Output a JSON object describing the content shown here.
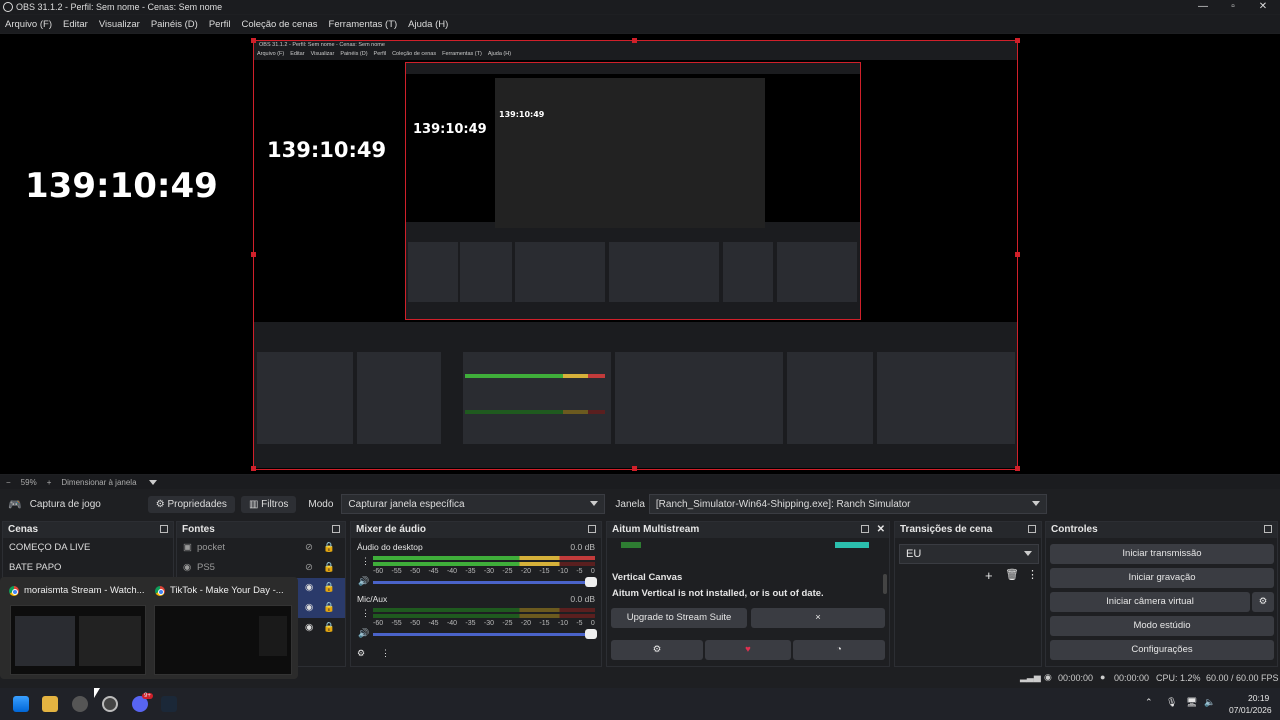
{
  "window": {
    "title": "OBS 31.1.2 - Perfil: Sem nome - Cenas: Sem nome"
  },
  "menu": [
    "Arquivo (F)",
    "Editar",
    "Visualizar",
    "Painéis (D)",
    "Perfil",
    "Coleção de cenas",
    "Ferramentas (T)",
    "Ajuda (H)"
  ],
  "preview": {
    "clock_text": "139:10:49",
    "nested_title": "OBS 31.1.2 - Perfil: Sem nome - Cenas: Sem nome",
    "nested_menu": [
      "Arquivo (F)",
      "Editar",
      "Visualizar",
      "Painéis (D)",
      "Perfil",
      "Coleção de cenas",
      "Ferramentas (T)",
      "Ajuda (H)"
    ]
  },
  "zoombar": {
    "zoom": "59%",
    "resize_label": "Dimensionar à janela"
  },
  "source_toolbar": {
    "source_name": "Captura de jogo",
    "properties_label": "Propriedades",
    "filters_label": "Filtros",
    "mode_label": "Modo",
    "mode_value": "Capturar janela específica",
    "window_label": "Janela",
    "window_value": "[Ranch_Simulator-Win64-Shipping.exe]: Ranch Simulator"
  },
  "scenes": {
    "title": "Cenas",
    "items": [
      "COMEÇO DA LIVE",
      "BATE PAPO"
    ]
  },
  "sources": {
    "title": "Fontes",
    "items": [
      "pocket",
      "PS5"
    ]
  },
  "mixer": {
    "title": "Mixer de áudio",
    "channels": [
      {
        "name": "Áudio do desktop",
        "db": "0.0 dB"
      },
      {
        "name": "Mic/Aux",
        "db": "0.0 dB"
      }
    ],
    "scale": [
      "-60",
      "-55",
      "-50",
      "-45",
      "-40",
      "-35",
      "-30",
      "-25",
      "-20",
      "-15",
      "-10",
      "-5",
      "0"
    ]
  },
  "multistream": {
    "title": "Aitum Multistream",
    "vertical_title": "Vertical Canvas",
    "vertical_msg": "Aitum Vertical is not installed, or is out of date.",
    "upgrade_label": "Upgrade to Stream Suite",
    "close_label": "×"
  },
  "transitions": {
    "title": "Transições de cena",
    "selected": "EU"
  },
  "controls": {
    "title": "Controles",
    "buttons": [
      "Iniciar transmissão",
      "Iniciar gravação",
      "Iniciar câmera virtual",
      "Modo estúdio",
      "Configurações"
    ]
  },
  "status": {
    "stream_time": "00:00:00",
    "rec_time": "00:00:00",
    "cpu": "CPU: 1.2%",
    "fps": "60.00 / 60.00 FPS"
  },
  "taskbar": {
    "time": "20:19",
    "date": "07/01/2026",
    "discord_badge": "9+"
  },
  "popup": {
    "items": [
      {
        "title": "moraismta Stream - Watch..."
      },
      {
        "title": "TikTok - Make Your Day -..."
      }
    ]
  },
  "colors": {
    "accent_red": "#d0202a",
    "meter_green": "#3fae3a",
    "meter_yellow": "#d6b13a",
    "meter_red": "#c23b3b"
  }
}
